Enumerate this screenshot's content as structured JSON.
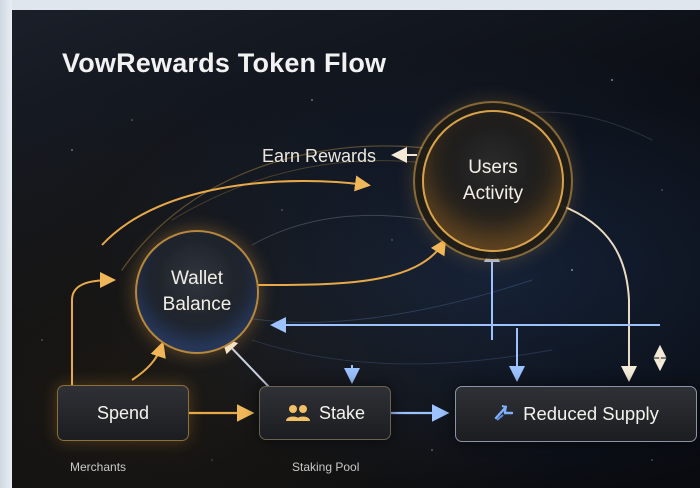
{
  "title": "VowRewards Token Flow",
  "nodes": {
    "users_activity": {
      "line1": "Users",
      "line2": "Activity"
    },
    "wallet_balance": {
      "line1": "Wallet",
      "line2": "Balance"
    },
    "spend": "Spend",
    "stake": "Stake",
    "reduced_supply": "Reduced Supply"
  },
  "labels": {
    "earn_rewards": "Earn Rewards",
    "merchants": "Merchants",
    "staking_pool": "Staking Pool"
  },
  "colors": {
    "background": "#0b0e14",
    "gold_flow": "#e8a94a",
    "blue_flow": "#6fa3f0",
    "text": "#f2f2f2"
  },
  "icons": {
    "stake": "people-icon",
    "reduced_supply": "arrow-swap-icon"
  }
}
